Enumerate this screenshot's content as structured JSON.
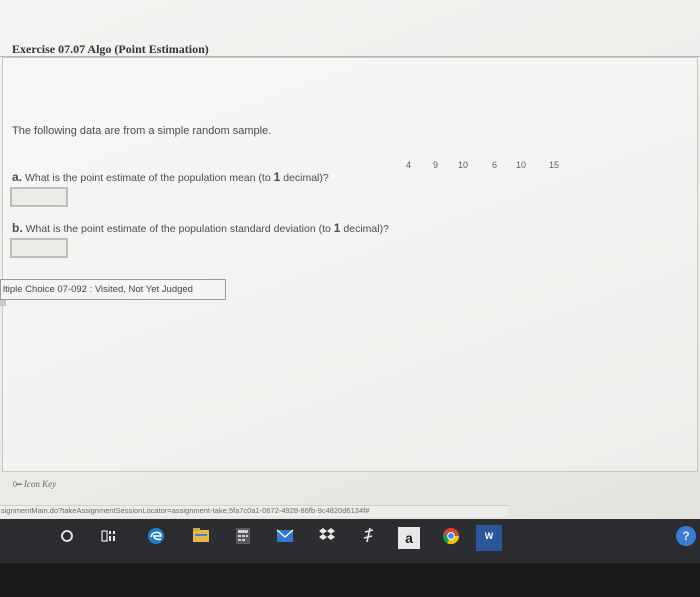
{
  "exercise": {
    "title": "Exercise 07.07 Algo (Point Estimation)"
  },
  "problem": {
    "prompt": "The following data are from a simple random sample.",
    "data": [
      "4",
      "9",
      "10",
      "6",
      "10",
      "15"
    ]
  },
  "questions": {
    "a_letter": "a.",
    "a_text": "What is the point estimate of the population mean (to",
    "a_num": "1",
    "a_end": "decimal)?",
    "a_value": "",
    "b_letter": "b.",
    "b_text": "What is the point estimate of the population standard deviation (to",
    "b_num": "1",
    "b_end": "decimal)?",
    "b_value": ""
  },
  "status": {
    "text": "ltiple Choice 07-092 : Visited, Not Yet Judged"
  },
  "icon_key": {
    "label": "Icon Key"
  },
  "browser": {
    "url": "signmentMain.do?takeAssignmentSessionLocator=assignment-take,5fa7c0a1-0672-4928-86fb-9c4820d6134f#"
  },
  "taskbar": {
    "items": [
      "start-icon",
      "task-view-icon",
      "edge-icon",
      "file-explorer-icon",
      "calculator-icon",
      "mail-icon",
      "dropbox-icon",
      "slack-icon",
      "amazon-icon",
      "chrome-icon",
      "word-icon",
      "help-icon"
    ],
    "amazon_letter": "a",
    "word_letter": "W",
    "help_letter": "?"
  },
  "colors": {
    "taskbar": "#2b2d31",
    "page": "#f1f1ef",
    "text": "#4b4b55"
  }
}
